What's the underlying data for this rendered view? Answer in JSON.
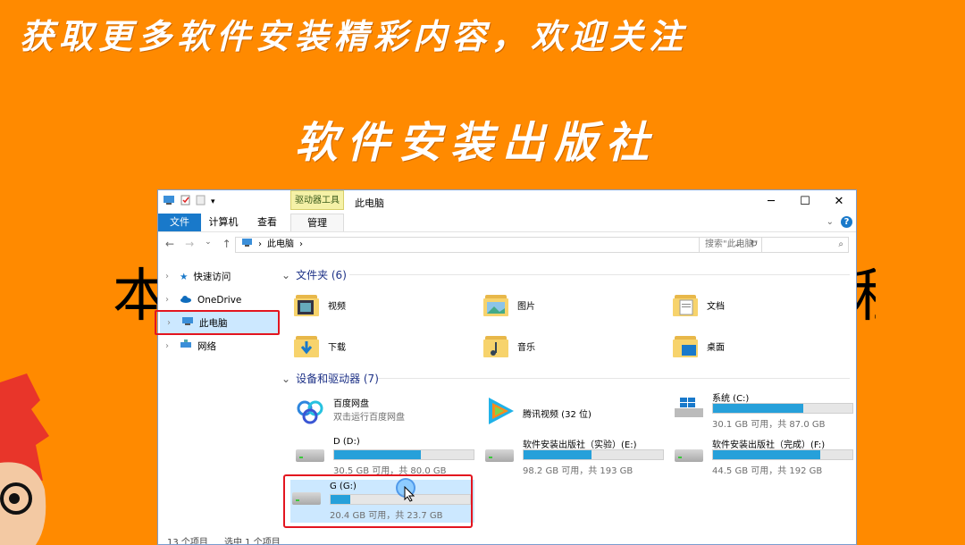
{
  "banner": {
    "top": "获取更多软件安装精彩内容，欢迎关注",
    "middle": "软件安装出版社",
    "big_left": "本",
    "big_right": "程"
  },
  "window": {
    "title": "此电脑",
    "context_tab": "驱动器工具",
    "ribbon_tabs": [
      "文件",
      "计算机",
      "查看",
      "管理"
    ],
    "address": "此电脑",
    "search_placeholder": "搜索\"此电脑\""
  },
  "sidebar": {
    "items": [
      {
        "label": "快速访问",
        "icon": "star-icon"
      },
      {
        "label": "OneDrive",
        "icon": "cloud-icon"
      },
      {
        "label": "此电脑",
        "icon": "computer-icon"
      },
      {
        "label": "网络",
        "icon": "network-icon"
      }
    ]
  },
  "folders_group": {
    "title": "文件夹 (6)",
    "items": [
      "视频",
      "图片",
      "文档",
      "下载",
      "音乐",
      "桌面"
    ]
  },
  "devices_group": {
    "title": "设备和驱动器 (7)",
    "apps": [
      {
        "name": "百度网盘",
        "sub": "双击运行百度网盘"
      },
      {
        "name": "腾讯视频 (32 位)",
        "sub": ""
      }
    ],
    "drives": [
      {
        "name": "系统 (C:)",
        "size": "30.1 GB 可用，共 87.0 GB",
        "used_fraction": 0.65
      },
      {
        "name": "D (D:)",
        "size": "30.5 GB 可用，共 80.0 GB",
        "used_fraction": 0.62
      },
      {
        "name": "软件安装出版社（实验）(E:)",
        "size": "98.2 GB 可用，共 193 GB",
        "used_fraction": 0.49
      },
      {
        "name": "软件安装出版社（完成）(F:)",
        "size": "44.5 GB 可用，共 192 GB",
        "used_fraction": 0.77
      },
      {
        "name": "G (G:)",
        "size": "20.4 GB 可用，共 23.7 GB",
        "used_fraction": 0.14
      }
    ]
  },
  "status": {
    "count": "13 个项目",
    "selected": "选中 1 个项目"
  },
  "colors": {
    "background": "#ff8a00",
    "accent": "#1979ca",
    "highlight_box": "#e3151f",
    "drive_bar": "#26a0da"
  }
}
